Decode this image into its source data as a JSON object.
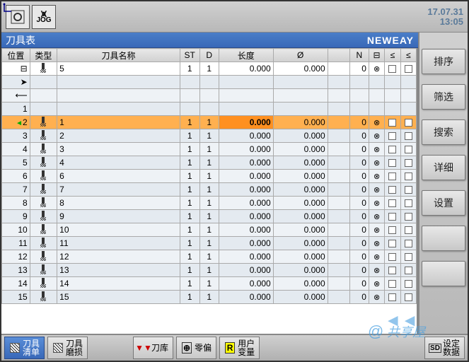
{
  "header": {
    "date": "17.07.31",
    "time": "13:05",
    "mode1": "⊙",
    "mode2": "JOG",
    "mode2_sym": "⩙"
  },
  "title": {
    "label": "刀具表",
    "brand": "NEWEAY"
  },
  "columns": {
    "pos": "位置",
    "type": "类型",
    "name": "刀具名称",
    "st": "ST",
    "d": "D",
    "len": "长度",
    "dia": "Ø",
    "n": "N",
    "i1": "⊟",
    "i2": "≤",
    "i3": "≤"
  },
  "rows": [
    {
      "pos": "⊟",
      "type": "tool",
      "name": "5",
      "st": "1",
      "d": "1",
      "len": "0.000",
      "dia": "0.000",
      "n": "0",
      "i1": "⊗",
      "i2": "box",
      "i3": "box",
      "white": true
    },
    {
      "pos": "➤",
      "type": "",
      "name": "",
      "st": "",
      "d": "",
      "len": "",
      "dia": "",
      "n": "",
      "i1": "",
      "i2": "",
      "i3": ""
    },
    {
      "pos": "⟵",
      "type": "",
      "name": "",
      "st": "",
      "d": "",
      "len": "",
      "dia": "",
      "n": "",
      "i1": "",
      "i2": "",
      "i3": ""
    },
    {
      "pos": "1",
      "type": "",
      "name": "",
      "st": "",
      "d": "",
      "len": "",
      "dia": "",
      "n": "",
      "i1": "",
      "i2": "",
      "i3": ""
    },
    {
      "pos": "2",
      "type": "tool",
      "name": "1",
      "st": "1",
      "d": "1",
      "len": "0.000",
      "dia": "0.000",
      "n": "0",
      "i1": "⊗",
      "i2": "box",
      "i3": "box",
      "sel": true,
      "mark": "◄"
    },
    {
      "pos": "3",
      "type": "tool",
      "name": "2",
      "st": "1",
      "d": "1",
      "len": "0.000",
      "dia": "0.000",
      "n": "0",
      "i1": "⊗",
      "i2": "box",
      "i3": "box"
    },
    {
      "pos": "4",
      "type": "tool",
      "name": "3",
      "st": "1",
      "d": "1",
      "len": "0.000",
      "dia": "0.000",
      "n": "0",
      "i1": "⊗",
      "i2": "box",
      "i3": "box"
    },
    {
      "pos": "5",
      "type": "tool",
      "name": "4",
      "st": "1",
      "d": "1",
      "len": "0.000",
      "dia": "0.000",
      "n": "0",
      "i1": "⊗",
      "i2": "box",
      "i3": "box"
    },
    {
      "pos": "6",
      "type": "tool",
      "name": "6",
      "st": "1",
      "d": "1",
      "len": "0.000",
      "dia": "0.000",
      "n": "0",
      "i1": "⊗",
      "i2": "box",
      "i3": "box"
    },
    {
      "pos": "7",
      "type": "tool",
      "name": "7",
      "st": "1",
      "d": "1",
      "len": "0.000",
      "dia": "0.000",
      "n": "0",
      "i1": "⊗",
      "i2": "box",
      "i3": "box"
    },
    {
      "pos": "8",
      "type": "tool",
      "name": "8",
      "st": "1",
      "d": "1",
      "len": "0.000",
      "dia": "0.000",
      "n": "0",
      "i1": "⊗",
      "i2": "box",
      "i3": "box"
    },
    {
      "pos": "9",
      "type": "tool",
      "name": "9",
      "st": "1",
      "d": "1",
      "len": "0.000",
      "dia": "0.000",
      "n": "0",
      "i1": "⊗",
      "i2": "box",
      "i3": "box"
    },
    {
      "pos": "10",
      "type": "tool",
      "name": "10",
      "st": "1",
      "d": "1",
      "len": "0.000",
      "dia": "0.000",
      "n": "0",
      "i1": "⊗",
      "i2": "box",
      "i3": "box"
    },
    {
      "pos": "11",
      "type": "tool",
      "name": "11",
      "st": "1",
      "d": "1",
      "len": "0.000",
      "dia": "0.000",
      "n": "0",
      "i1": "⊗",
      "i2": "box",
      "i3": "box"
    },
    {
      "pos": "12",
      "type": "tool",
      "name": "12",
      "st": "1",
      "d": "1",
      "len": "0.000",
      "dia": "0.000",
      "n": "0",
      "i1": "⊗",
      "i2": "box",
      "i3": "box"
    },
    {
      "pos": "13",
      "type": "tool",
      "name": "13",
      "st": "1",
      "d": "1",
      "len": "0.000",
      "dia": "0.000",
      "n": "0",
      "i1": "⊗",
      "i2": "box",
      "i3": "box"
    },
    {
      "pos": "14",
      "type": "tool",
      "name": "14",
      "st": "1",
      "d": "1",
      "len": "0.000",
      "dia": "0.000",
      "n": "0",
      "i1": "⊗",
      "i2": "box",
      "i3": "box"
    },
    {
      "pos": "15",
      "type": "tool",
      "name": "15",
      "st": "1",
      "d": "1",
      "len": "0.000",
      "dia": "0.000",
      "n": "0",
      "i1": "⊗",
      "i2": "box",
      "i3": "box"
    }
  ],
  "sidebar": [
    {
      "label": "排序"
    },
    {
      "label": "筛选"
    },
    {
      "label": "搜索"
    },
    {
      "label": "详细"
    },
    {
      "label": "设置"
    },
    {
      "label": ""
    },
    {
      "label": ""
    }
  ],
  "bottombar": [
    {
      "icon": "hatch",
      "label": "刀具\n清单",
      "active": true
    },
    {
      "icon": "hatch",
      "label": "刀具\n磨损"
    },
    {
      "icon": "pins",
      "label": "刀库"
    },
    {
      "icon": "target",
      "label": "零偏"
    },
    {
      "icon": "R",
      "label": "用户\n变量"
    },
    {
      "icon": "SD",
      "label": "设定\n数据",
      "right": true
    }
  ],
  "watermark": "共享屋"
}
